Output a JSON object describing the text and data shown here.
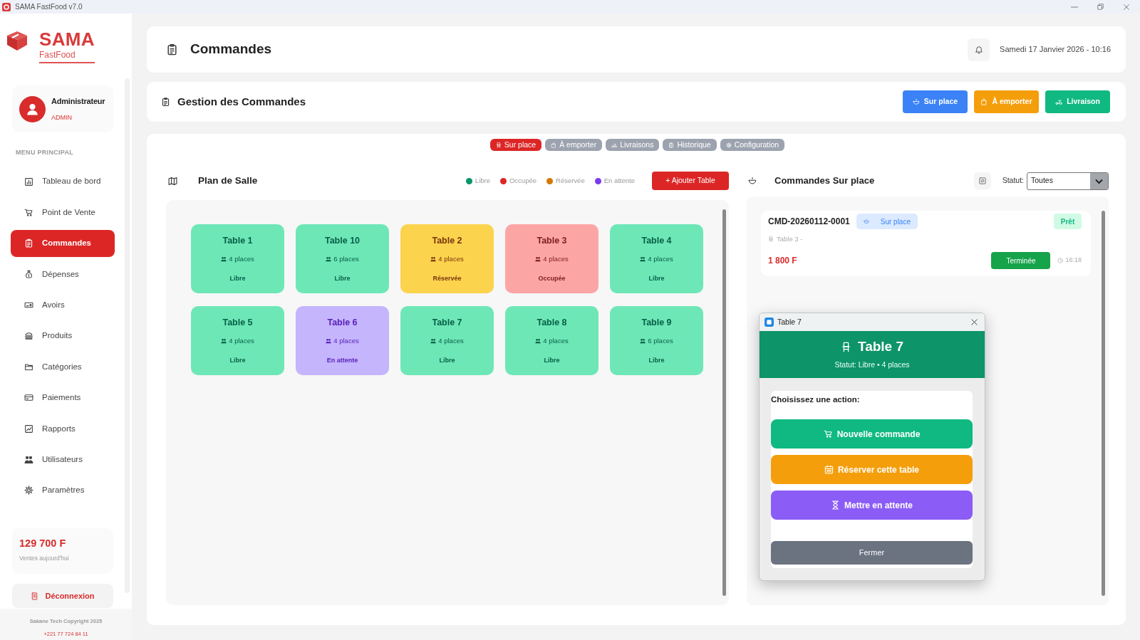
{
  "window": {
    "title": "SAMA FastFood v7.0"
  },
  "sidebar": {
    "brand": {
      "name": "SAMA",
      "subtitle": "FastFood"
    },
    "user": {
      "name": "Administrateur",
      "role": "ADMIN"
    },
    "menu_title": "MENU PRINCIPAL",
    "items": [
      {
        "label": "Tableau de bord",
        "selected": false
      },
      {
        "label": "Point de Vente",
        "selected": false
      },
      {
        "label": "Commandes",
        "selected": true
      },
      {
        "label": "Dépenses",
        "selected": false
      },
      {
        "label": "Avoirs",
        "selected": false
      },
      {
        "label": "Produits",
        "selected": false
      },
      {
        "label": "Catégories",
        "selected": false
      },
      {
        "label": "Paiements",
        "selected": false
      },
      {
        "label": "Rapports",
        "selected": false
      },
      {
        "label": "Utilisateurs",
        "selected": false
      },
      {
        "label": "Paramètres",
        "selected": false
      }
    ],
    "sales": {
      "amount": "129 700 F",
      "label": "Ventes aujourd'hui"
    },
    "logout": "Déconnexion",
    "footer": {
      "copyright": "Sakane Tech Copyright 2025",
      "phone": "+221 77 724 84 11"
    }
  },
  "header": {
    "title": "Commandes",
    "date": "Samedi 17 Janvier 2026 - 10:16"
  },
  "toolbar": {
    "title": "Gestion des Commandes",
    "buttons": [
      {
        "label": "Sur place",
        "kind": "dine"
      },
      {
        "label": "À emporter",
        "kind": "takeaway"
      },
      {
        "label": "Livraison",
        "kind": "delivery"
      }
    ]
  },
  "tabs": [
    {
      "label": "Sur place",
      "selected": true
    },
    {
      "label": "À emporter",
      "selected": false
    },
    {
      "label": "Livraisons",
      "selected": false
    },
    {
      "label": "Historique",
      "selected": false
    },
    {
      "label": "Configuration",
      "selected": false
    }
  ],
  "floor_plan": {
    "title": "Plan de Salle",
    "legend": [
      {
        "label": "Libre",
        "color": "#059669"
      },
      {
        "label": "Occupée",
        "color": "#dc2626"
      },
      {
        "label": "Réservée",
        "color": "#d97706"
      },
      {
        "label": "En attente",
        "color": "#7c3aed"
      }
    ],
    "add_button": "+ Ajouter Table",
    "tables": [
      {
        "name": "Table 1",
        "seats": "4 places",
        "status": "Libre",
        "kind": "free"
      },
      {
        "name": "Table 10",
        "seats": "6 places",
        "status": "Libre",
        "kind": "free"
      },
      {
        "name": "Table 2",
        "seats": "4 places",
        "status": "Réservée",
        "kind": "reserved"
      },
      {
        "name": "Table 3",
        "seats": "4 places",
        "status": "Occupée",
        "kind": "occupied"
      },
      {
        "name": "Table 4",
        "seats": "4 places",
        "status": "Libre",
        "kind": "free"
      },
      {
        "name": "Table 5",
        "seats": "4 places",
        "status": "Libre",
        "kind": "free"
      },
      {
        "name": "Table 6",
        "seats": "4 places",
        "status": "En attente",
        "kind": "waiting"
      },
      {
        "name": "Table 7",
        "seats": "4 places",
        "status": "Libre",
        "kind": "free"
      },
      {
        "name": "Table 8",
        "seats": "4 places",
        "status": "Libre",
        "kind": "free"
      },
      {
        "name": "Table 9",
        "seats": "6 places",
        "status": "Libre",
        "kind": "free"
      }
    ]
  },
  "orders": {
    "title": "Commandes Sur place",
    "filter": {
      "label": "Statut:",
      "value": "Toutes"
    },
    "items": [
      {
        "code": "CMD-20260112-0001",
        "type": "Sur place",
        "state": "Prêt",
        "table": "Table 3 -",
        "total": "1 800 F",
        "status": "Terminée",
        "time": "16:18"
      }
    ]
  },
  "dialog": {
    "title": "Table 7",
    "heading": "Table 7",
    "subtitle": "Statut: Libre • 4 places",
    "prompt": "Choisissez une action:",
    "actions": [
      {
        "label": "Nouvelle commande",
        "kind": "new-order"
      },
      {
        "label": "Réserver cette table",
        "kind": "reserve"
      },
      {
        "label": "Mettre en attente",
        "kind": "hold"
      }
    ],
    "close_button": "Fermer"
  }
}
